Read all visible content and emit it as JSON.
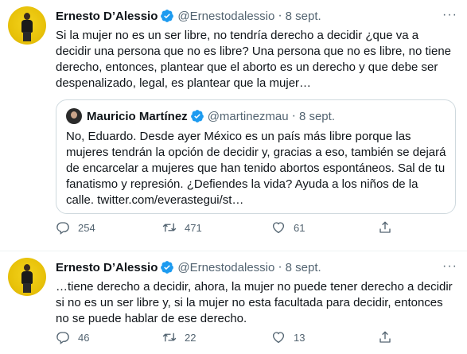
{
  "tweets": [
    {
      "author_name": "Ernesto D’Alessio",
      "handle": "@Ernestodalessio",
      "separator": "·",
      "date": "8 sept.",
      "more": "···",
      "text": "Si la mujer no es un ser libre, no tendría derecho a decidir ¿que va a decidir una persona que no es libre? Una persona que no es libre, no tiene derecho, entonces, plantear que el aborto es un derecho y que debe ser despenalizado, legal, es plantear que la mujer…",
      "quote": {
        "author_name": "Mauricio Martínez",
        "handle": "@martinezmau",
        "separator": "·",
        "date": "8 sept.",
        "text": "No, Eduardo. Desde ayer México es un país más libre porque las mujeres tendrán la opción de decidir y, gracias a eso, también se dejará de encarcelar a mujeres que han tenido abortos espontáneos. Sal de tu fanatismo y represión. ¿Defiendes la vida? Ayuda a los niños de la calle. twitter.com/everastegui/st…"
      },
      "replies": "254",
      "retweets": "471",
      "likes": "61"
    },
    {
      "author_name": "Ernesto D’Alessio",
      "handle": "@Ernestodalessio",
      "separator": "·",
      "date": "8 sept.",
      "more": "···",
      "text": "…tiene derecho a decidir, ahora, la mujer no puede tener derecho a decidir si no es un ser libre y,  si la mujer no esta facultada para decidir, entonces no se puede hablar de ese derecho.",
      "replies": "46",
      "retweets": "22",
      "likes": "13"
    }
  ],
  "colors": {
    "verified": "#1d9bf0",
    "secondary_text": "#536471",
    "avatar_bg": "#f3d21c"
  },
  "icons": [
    "verified-badge-icon",
    "reply-icon",
    "retweet-icon",
    "like-icon",
    "share-icon",
    "more-icon"
  ]
}
